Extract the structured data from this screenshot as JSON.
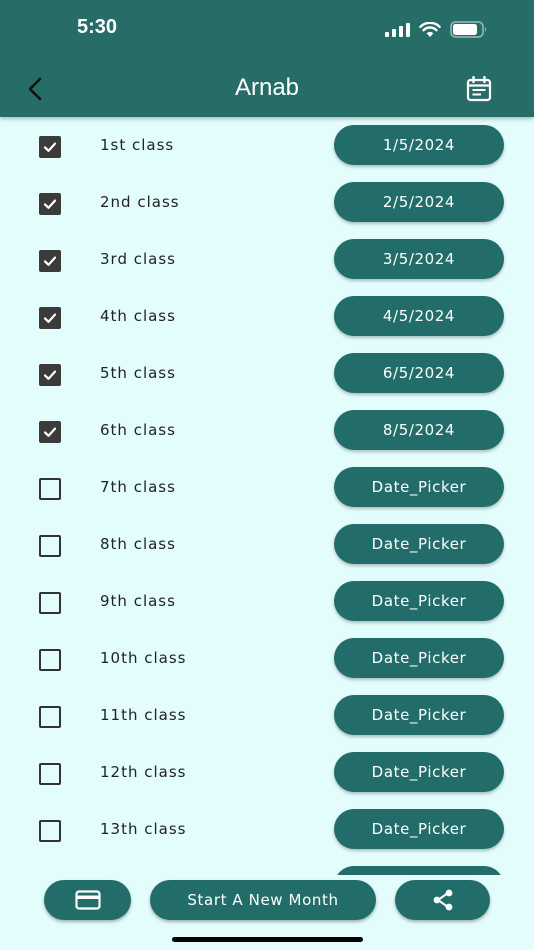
{
  "status_bar": {
    "time": "5:30"
  },
  "header": {
    "title": "Arnab"
  },
  "classes": [
    {
      "label": "1st class",
      "checked": true,
      "date": "1/5/2024"
    },
    {
      "label": "2nd class",
      "checked": true,
      "date": "2/5/2024"
    },
    {
      "label": "3rd class",
      "checked": true,
      "date": "3/5/2024"
    },
    {
      "label": "4th class",
      "checked": true,
      "date": "4/5/2024"
    },
    {
      "label": "5th class",
      "checked": true,
      "date": "6/5/2024"
    },
    {
      "label": "6th class",
      "checked": true,
      "date": "8/5/2024"
    },
    {
      "label": "7th class",
      "checked": false,
      "date": "Date_Picker"
    },
    {
      "label": "8th class",
      "checked": false,
      "date": "Date_Picker"
    },
    {
      "label": "9th class",
      "checked": false,
      "date": "Date_Picker"
    },
    {
      "label": "10th class",
      "checked": false,
      "date": "Date_Picker"
    },
    {
      "label": "11th class",
      "checked": false,
      "date": "Date_Picker"
    },
    {
      "label": "12th class",
      "checked": false,
      "date": "Date_Picker"
    },
    {
      "label": "13th class",
      "checked": false,
      "date": "Date_Picker"
    },
    {
      "label": "",
      "checked": false,
      "date": ""
    }
  ],
  "bottom": {
    "payment_icon": "credit-card-icon",
    "new_month_label": "Start A New Month",
    "share_icon": "share-icon"
  },
  "colors": {
    "header": "#256d66",
    "button": "#226d6a",
    "background": "#e3fdfd"
  }
}
